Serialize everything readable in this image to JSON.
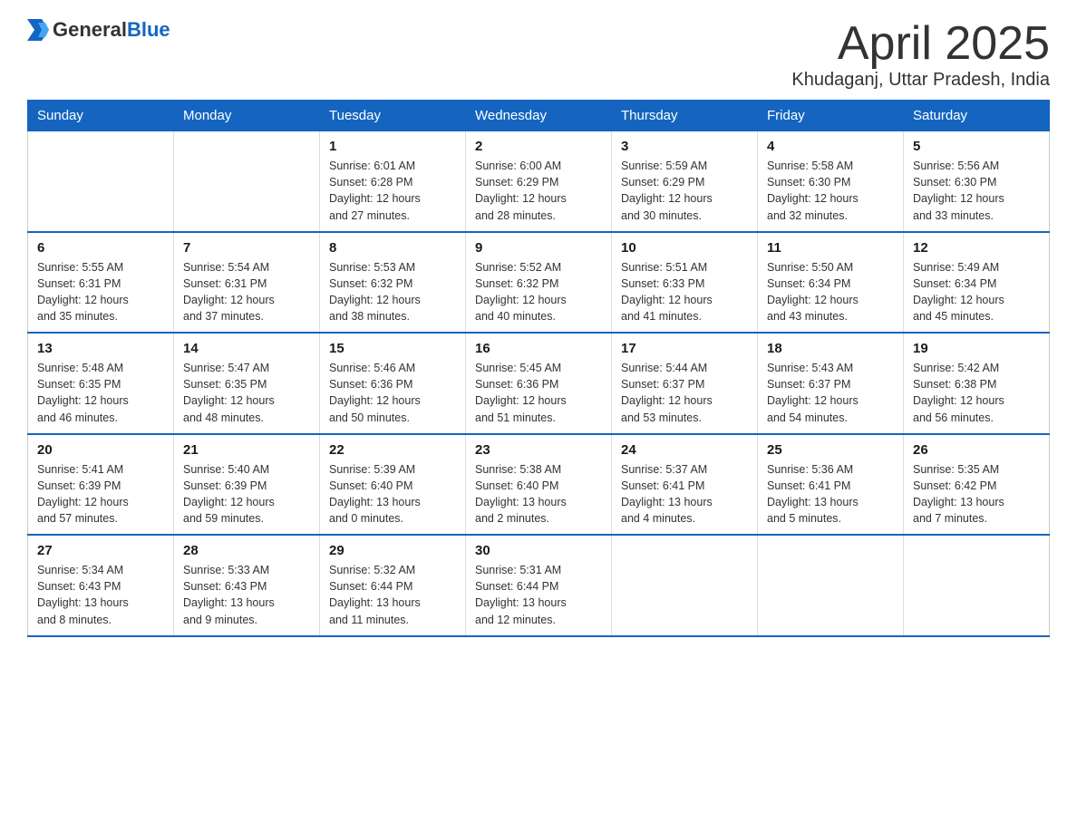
{
  "logo": {
    "text_general": "General",
    "text_blue": "Blue"
  },
  "title": "April 2025",
  "location": "Khudaganj, Uttar Pradesh, India",
  "weekdays": [
    "Sunday",
    "Monday",
    "Tuesday",
    "Wednesday",
    "Thursday",
    "Friday",
    "Saturday"
  ],
  "weeks": [
    [
      {
        "day": "",
        "info": ""
      },
      {
        "day": "",
        "info": ""
      },
      {
        "day": "1",
        "info": "Sunrise: 6:01 AM\nSunset: 6:28 PM\nDaylight: 12 hours\nand 27 minutes."
      },
      {
        "day": "2",
        "info": "Sunrise: 6:00 AM\nSunset: 6:29 PM\nDaylight: 12 hours\nand 28 minutes."
      },
      {
        "day": "3",
        "info": "Sunrise: 5:59 AM\nSunset: 6:29 PM\nDaylight: 12 hours\nand 30 minutes."
      },
      {
        "day": "4",
        "info": "Sunrise: 5:58 AM\nSunset: 6:30 PM\nDaylight: 12 hours\nand 32 minutes."
      },
      {
        "day": "5",
        "info": "Sunrise: 5:56 AM\nSunset: 6:30 PM\nDaylight: 12 hours\nand 33 minutes."
      }
    ],
    [
      {
        "day": "6",
        "info": "Sunrise: 5:55 AM\nSunset: 6:31 PM\nDaylight: 12 hours\nand 35 minutes."
      },
      {
        "day": "7",
        "info": "Sunrise: 5:54 AM\nSunset: 6:31 PM\nDaylight: 12 hours\nand 37 minutes."
      },
      {
        "day": "8",
        "info": "Sunrise: 5:53 AM\nSunset: 6:32 PM\nDaylight: 12 hours\nand 38 minutes."
      },
      {
        "day": "9",
        "info": "Sunrise: 5:52 AM\nSunset: 6:32 PM\nDaylight: 12 hours\nand 40 minutes."
      },
      {
        "day": "10",
        "info": "Sunrise: 5:51 AM\nSunset: 6:33 PM\nDaylight: 12 hours\nand 41 minutes."
      },
      {
        "day": "11",
        "info": "Sunrise: 5:50 AM\nSunset: 6:34 PM\nDaylight: 12 hours\nand 43 minutes."
      },
      {
        "day": "12",
        "info": "Sunrise: 5:49 AM\nSunset: 6:34 PM\nDaylight: 12 hours\nand 45 minutes."
      }
    ],
    [
      {
        "day": "13",
        "info": "Sunrise: 5:48 AM\nSunset: 6:35 PM\nDaylight: 12 hours\nand 46 minutes."
      },
      {
        "day": "14",
        "info": "Sunrise: 5:47 AM\nSunset: 6:35 PM\nDaylight: 12 hours\nand 48 minutes."
      },
      {
        "day": "15",
        "info": "Sunrise: 5:46 AM\nSunset: 6:36 PM\nDaylight: 12 hours\nand 50 minutes."
      },
      {
        "day": "16",
        "info": "Sunrise: 5:45 AM\nSunset: 6:36 PM\nDaylight: 12 hours\nand 51 minutes."
      },
      {
        "day": "17",
        "info": "Sunrise: 5:44 AM\nSunset: 6:37 PM\nDaylight: 12 hours\nand 53 minutes."
      },
      {
        "day": "18",
        "info": "Sunrise: 5:43 AM\nSunset: 6:37 PM\nDaylight: 12 hours\nand 54 minutes."
      },
      {
        "day": "19",
        "info": "Sunrise: 5:42 AM\nSunset: 6:38 PM\nDaylight: 12 hours\nand 56 minutes."
      }
    ],
    [
      {
        "day": "20",
        "info": "Sunrise: 5:41 AM\nSunset: 6:39 PM\nDaylight: 12 hours\nand 57 minutes."
      },
      {
        "day": "21",
        "info": "Sunrise: 5:40 AM\nSunset: 6:39 PM\nDaylight: 12 hours\nand 59 minutes."
      },
      {
        "day": "22",
        "info": "Sunrise: 5:39 AM\nSunset: 6:40 PM\nDaylight: 13 hours\nand 0 minutes."
      },
      {
        "day": "23",
        "info": "Sunrise: 5:38 AM\nSunset: 6:40 PM\nDaylight: 13 hours\nand 2 minutes."
      },
      {
        "day": "24",
        "info": "Sunrise: 5:37 AM\nSunset: 6:41 PM\nDaylight: 13 hours\nand 4 minutes."
      },
      {
        "day": "25",
        "info": "Sunrise: 5:36 AM\nSunset: 6:41 PM\nDaylight: 13 hours\nand 5 minutes."
      },
      {
        "day": "26",
        "info": "Sunrise: 5:35 AM\nSunset: 6:42 PM\nDaylight: 13 hours\nand 7 minutes."
      }
    ],
    [
      {
        "day": "27",
        "info": "Sunrise: 5:34 AM\nSunset: 6:43 PM\nDaylight: 13 hours\nand 8 minutes."
      },
      {
        "day": "28",
        "info": "Sunrise: 5:33 AM\nSunset: 6:43 PM\nDaylight: 13 hours\nand 9 minutes."
      },
      {
        "day": "29",
        "info": "Sunrise: 5:32 AM\nSunset: 6:44 PM\nDaylight: 13 hours\nand 11 minutes."
      },
      {
        "day": "30",
        "info": "Sunrise: 5:31 AM\nSunset: 6:44 PM\nDaylight: 13 hours\nand 12 minutes."
      },
      {
        "day": "",
        "info": ""
      },
      {
        "day": "",
        "info": ""
      },
      {
        "day": "",
        "info": ""
      }
    ]
  ]
}
